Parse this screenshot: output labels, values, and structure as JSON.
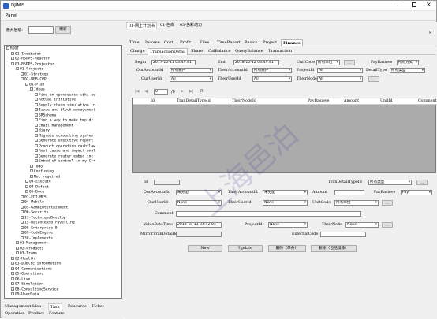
{
  "window": {
    "title": "DJIMIS"
  },
  "menu": {
    "item": "Panel"
  },
  "sidebar": {
    "level_label": "展开层级:",
    "level_value": "",
    "refresh_label": "刷新",
    "tree": [
      "ROOT",
      "01-Incubator",
      "02-RSPPS-Reactor",
      "03-RSPPS-Projector",
      "01-Projects",
      "01-Strategy",
      "02-WEB-CPP",
      "01-Plan",
      "Ideas",
      "Find an opensource wiki as",
      "Actual initiative",
      "Supply chain simulation in",
      "Issue and block management",
      "SRSchema",
      "Find a way to make tmp dr",
      "Email management",
      "diary",
      "Migrate accounting system",
      "Generate executive report",
      "Product operation cashflow",
      "Root cause and impact anal",
      "Generate router embed inc",
      "Embed c# control in my C++",
      "Todo",
      "Confusing",
      "Not required",
      "04-Execute",
      "04-Defect",
      "05-Done",
      "03-EDI-MES",
      "04-Mobile",
      "05-GameEntertainment",
      "06-Security",
      "11-TechniqueDevelop",
      "15-BalanceAndTravelling",
      "08-Enterprise-0",
      "09-CodeEngine",
      "30-Implements",
      "01-Management",
      "02-Products",
      "03-Trams",
      "02-Health",
      "03-public information",
      "04-Communications",
      "05-Operations",
      "06-Live",
      "07-Simulation",
      "08-ConsultingService",
      "09-UserData"
    ],
    "bottom_tabs": [
      "Management",
      "Idea",
      "Task",
      "Resource",
      "Ticket",
      "Operation",
      "Product",
      "Feature"
    ]
  },
  "main": {
    "top_tabs": [
      "01-网上计划书",
      "01-色白",
      "03-色彩动力"
    ],
    "section_tabs": [
      "Time",
      "Income",
      "Cost",
      "Profit",
      "Files",
      "TimeReport",
      "Basics",
      "Project",
      "Finance"
    ],
    "sub_tabs": [
      "Charge",
      "TransactionDetail",
      "Share",
      "CalBalance",
      "QueryBalance",
      "Transaction"
    ],
    "filter": {
      "begin_label": "Begin",
      "begin_value": "2017-10-11 03:44:41",
      "end_label": "End",
      "end_value": "2018-10-12 03:44:41",
      "unitcode_label": "UnitCode",
      "unitcode_value": "所有单位",
      "paybasieve_label": "PayBasieve",
      "paybasieve_value": "所有方式",
      "ouraccount_label": "OurAccountId",
      "ouraccount_value": "所有账户",
      "theiraccount_label": "TheirAccountId",
      "theiraccount_value": "所有账户",
      "projectid_label": "ProjectId",
      "projectid_value": "All",
      "detailtype_label": "DetailType",
      "detailtype_value": "所有类型",
      "ouruser_label": "OurUserId",
      "ouruser_value": "All",
      "theiruser_label": "TheirUserId",
      "theiruser_value": "All",
      "theirnode_label": "TheirNode",
      "theirnode_value": "All"
    },
    "pager": {
      "page": "0",
      "of": "/0"
    },
    "grid_columns": [
      "Id",
      "TranDetailTypeId",
      "TheirNodeId",
      "PayBasieve",
      "Amount",
      "UnitId",
      "Comment"
    ],
    "form": {
      "id_label": "Id",
      "id_value": "",
      "detailtype_label": "TranDetailTypeId",
      "detailtype_value": "所有类型",
      "ouraccount_label": "OurAccountId",
      "ouraccount_value": "未分配",
      "theiraccount_label": "TheirAccountId",
      "theiraccount_value": "未分配",
      "amount_label": "Amount",
      "amount_value": "",
      "paybasieve_label": "PayBasieve",
      "paybasieve_value": "Pay",
      "ouruser_label": "OurUserId",
      "ouruser_value": "None",
      "theiruser_label": "TheirUserId",
      "theiruser_value": "None",
      "unitcode_label": "UnitCode",
      "unitcode_value": "所有单位",
      "comment_label": "Comment",
      "comment_value": "",
      "valuedate_label": "ValueDateTime",
      "valuedate_value": "2018-10-11 04:42:04",
      "projectid_label": "ProjectId",
      "projectid_value": "None",
      "theirnode_label": "TheirNode",
      "theirnode_value": "None",
      "mirror_label": "MirrorTranDetailId",
      "mirror_value": "",
      "external_label": "ExternalCode",
      "external_value": ""
    },
    "buttons": [
      "New",
      "Update",
      "删除（单条）",
      "删除（包括镜像）"
    ],
    "watermark": "上海邑泊"
  }
}
